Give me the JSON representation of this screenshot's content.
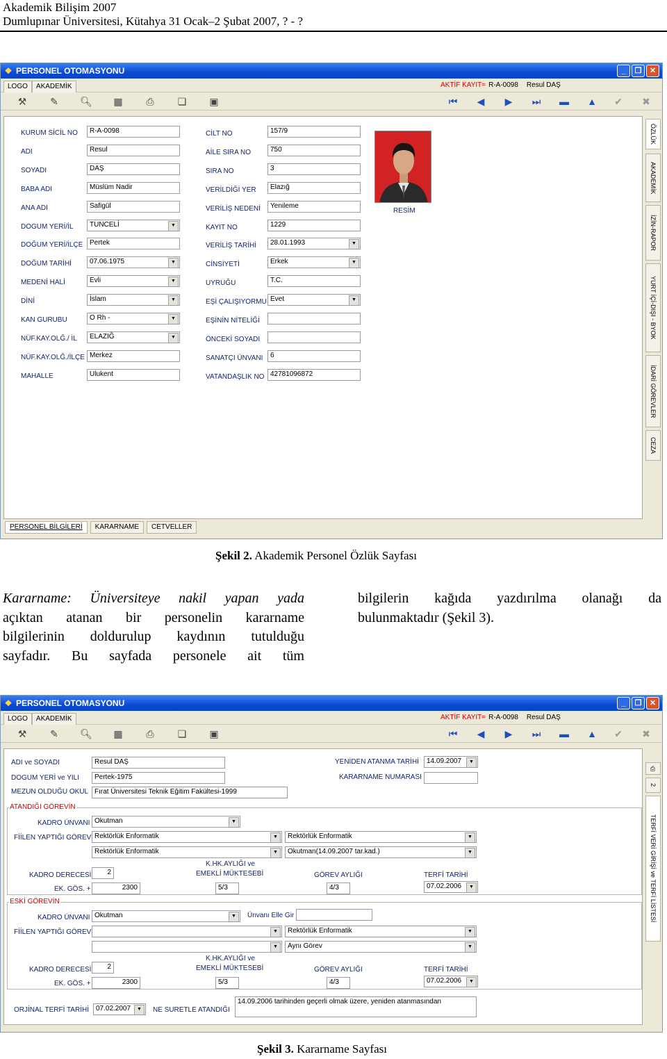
{
  "header": {
    "line1": "Akademik Bilişim 2007",
    "line2": "Dumlupınar Üniversitesi, Kütahya 31 Ocak–2 Şubat 2007, ? - ?"
  },
  "window1": {
    "title": "PERSONEL OTOMASYONU",
    "menu": [
      "LOGO",
      "AKADEMİK"
    ],
    "aktif_label": "AKTİF KAYIT=",
    "aktif_id": "R-A-0098",
    "aktif_name": "Resul DAŞ",
    "left_fields": [
      {
        "label": "KURUM SİCİL NO",
        "value": "R-A-0098"
      },
      {
        "label": "ADI",
        "value": "Resul"
      },
      {
        "label": "SOYADI",
        "value": "DAŞ"
      },
      {
        "label": "BABA ADI",
        "value": "Müslüm Nadir"
      },
      {
        "label": "ANA ADI",
        "value": "Safigül"
      },
      {
        "label": "DOGUM YERİ/İL",
        "value": "TUNCELİ"
      },
      {
        "label": "DOĞUM YERİ/İLÇE",
        "value": "Pertek"
      },
      {
        "label": "DOĞUM TARİHİ",
        "value": "07.06.1975"
      },
      {
        "label": "MEDENİ HALİ",
        "value": "Evli"
      },
      {
        "label": "DİNİ",
        "value": "İslam"
      },
      {
        "label": "KAN GURUBU",
        "value": "O Rh -"
      },
      {
        "label": "NÜF.KAY.OLĞ./ İL",
        "value": "ELAZIĞ"
      },
      {
        "label": "NÜF.KAY.OLĞ./İLÇE",
        "value": "Merkez"
      },
      {
        "label": "MAHALLE",
        "value": "Ulukent"
      }
    ],
    "right_fields": [
      {
        "label": "CİLT NO",
        "value": "157/9"
      },
      {
        "label": "AİLE SIRA NO",
        "value": "750"
      },
      {
        "label": "SIRA NO",
        "value": "3"
      },
      {
        "label": "VERİLDİĞİ YER",
        "value": "Elazığ"
      },
      {
        "label": "VERİLİŞ NEDENİ",
        "value": "Yenileme"
      },
      {
        "label": "KAYIT NO",
        "value": "1229"
      },
      {
        "label": "VERİLİŞ TARİHİ",
        "value": "28.01.1993"
      },
      {
        "label": "CİNSİYETİ",
        "value": "Erkek"
      },
      {
        "label": "UYRUĞU",
        "value": "T.C."
      },
      {
        "label": "EŞİ ÇALIŞIYORMU",
        "value": "Evet"
      },
      {
        "label": "EŞİNİN NİTELİĞİ",
        "value": ""
      },
      {
        "label": "ÖNCEKİ SOYADI",
        "value": ""
      },
      {
        "label": "SANATÇI ÜNVANI",
        "value": "6"
      },
      {
        "label": "VATANDAŞLIK NO",
        "value": "42781096872"
      }
    ],
    "photo_label": "RESİM",
    "vtabs": [
      "ÖZLÜK",
      "AKADEMİK",
      "İZİN-RAPOR",
      "YURT İÇİ-DIŞI - BYOK",
      "İDARİ GÖREVLER",
      "CEZA"
    ],
    "bottom_tabs": [
      "PERSONEL BİLGİLERİ",
      "KARARNAME",
      "CETVELLER"
    ]
  },
  "caption1_bold": "Şekil 2.",
  "caption1_rest": " Akademik Personel Özlük Sayfası",
  "para_left": [
    "Kararname: Üniversiteye nakil yapan yada",
    "açıktan atanan bir personelin kararname",
    "bilgilerinin doldurulup kaydının tutulduğu"
  ],
  "para_left_last": "sayfadır. Bu sayfada personele ait tüm",
  "para_right": [
    "bilgilerin kağıda yazdırılma olanağı da"
  ],
  "para_right_last": "bulunmaktadır (Şekil 3).",
  "window2": {
    "title": "PERSONEL OTOMASYONU",
    "adi_soyadi_label": "ADI ve SOYADI",
    "adi_soyadi": "Resul DAŞ",
    "dogum_label": "DOGUM YERİ ve YILI",
    "dogum": "Pertek-1975",
    "mezun_label": "MEZUN OLDUĞU OKUL",
    "mezun": "Fırat Üniversitesi Teknik Eğitim Fakültesi-1999",
    "yeniden_label": "YENİDEN ATANMA TARİHİ",
    "yeniden": "14.09.2007",
    "kararname_no_label": "KARARNAME NUMARASI",
    "kararname_no": "",
    "atandigi_label": "ATANDIĞI GÖREVİN",
    "kadro_unvani_label": "KADRO ÜNVANI",
    "kadro_unvani": "Okutman",
    "fiilen_label": "FİİLEN YAPTIĞI GÖREV",
    "fiilen1": "Rektörlük Enformatik",
    "fiilen2": "Rektörlük Enformatik",
    "fiilen3": "Rektörlük Enformatik",
    "fiilen4": "Okutman(14.09.2007 tar.kad.)",
    "kadro_derecesi_label": "KADRO DERECESİ",
    "kadro_derecesi": "2",
    "ek_gos_label": "EK. GÖS. +",
    "ek_gos": "2300",
    "khk_label1": "K.HK.AYLIĞI ve",
    "khk_label2": "EMEKLİ MÜKTESEBİ",
    "khk": "5/3",
    "gorev_ayligi_label": "GÖREV AYLIĞI",
    "gorev_ayligi": "4/3",
    "terfi_label": "TERFİ TARİHİ",
    "terfi": "07.02.2006",
    "eski_label": "ESKİ GÖREVİN",
    "eski_kadro": "Okutman",
    "unvani_elle_label": "Ünvanı Elle Gir",
    "unvani_elle": "",
    "eski_fiilen1": "",
    "eski_fiilen2": "Rektörlük Enformatik",
    "eski_fiilen3": "",
    "eski_fiilen4": "Aynı Görev",
    "eski_derece": "2",
    "eski_ek": "2300",
    "eski_khk": "5/3",
    "eski_gorev": "4/3",
    "eski_terfi": "07.02.2006",
    "orjinal_label": "ORJİNAL TERFİ TARİHİ",
    "orjinal": "07.02.2007",
    "ne_suretle_label": "NE SURETLE ATANDIĞI",
    "ne_suretle": "14.09.2006 tarihinden geçerli olmak üzere, yeniden atanmasından",
    "vtabs": [
      "2",
      "TERFİ VERİ GİRİŞİ ve TERFİ LİSTESİ"
    ]
  },
  "caption2_bold": "Şekil 3.",
  "caption2_rest": " Kararname Sayfası",
  "colors": {
    "title_blue": "#0a4ad3",
    "label_navy": "#13246b",
    "red_label": "#cc0000"
  }
}
